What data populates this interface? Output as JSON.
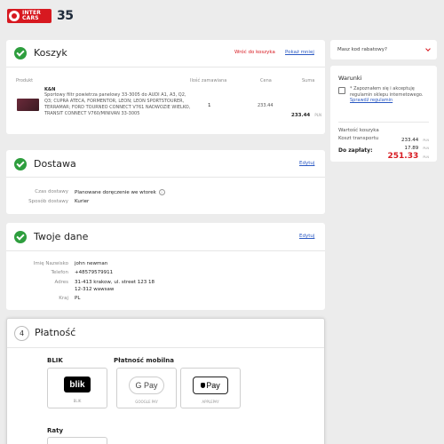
{
  "header": {
    "logo_line1": "INTER",
    "logo_line2": "CARS",
    "anniversary": "35"
  },
  "cart": {
    "title": "Koszyk",
    "return_link": "Wróć do koszyka",
    "show_less": "Pokaż mniej",
    "columns": {
      "product": "Produkt",
      "qty": "Ilość zamawiana",
      "price": "Cena",
      "sum": "Suma"
    },
    "item": {
      "brand": "K&N",
      "description": "Sportowy filtr powietrza panelowy 33-3005 do AUDI A1, A3, Q2, Q3; CUPRA ATECA, FORMENTOR, LEON; LEON SPORTSTOURER, TERRAMAR; FORD TOURNEO CONNECT V761 NADWOZIE WIELKO, TRANSIT CONNECT V760/MINIVAN 33-3005",
      "qty": "1",
      "price": "233.44",
      "sum": "233.44",
      "currency": "PLN"
    }
  },
  "delivery": {
    "title": "Dostawa",
    "edit": "Edytuj",
    "time_label": "Czas dostawy",
    "time_value": "Planowane doręczenie we wtorek",
    "method_label": "Sposób dostawy",
    "method_value": "Kurier"
  },
  "your_data": {
    "title": "Twoje dane",
    "edit": "Edytuj",
    "name_label": "Imię Nazwisko",
    "name_value": "john newman",
    "phone_label": "Telefon",
    "phone_value": "+48579579911",
    "address_label": "Adres",
    "address_line1": "31-413 krakow, ul. street 123 18",
    "address_line2": "12-312 wawsaw",
    "country_label": "Kraj",
    "country_value": "PL"
  },
  "payment": {
    "step": "4",
    "title": "Płatność",
    "blik_heading": "BLIK",
    "mobile_heading": "Płatność mobilna",
    "blik_logo": "blik",
    "blik_caption": "BLIK",
    "gpay_logo": "G Pay",
    "gpay_caption": "GOOGLE PAY",
    "apay_logo": "Pay",
    "apay_caption": "APPLEPAY",
    "installments_heading": "Raty"
  },
  "sidebar": {
    "discount_placeholder": "Masz kod rabatowy?",
    "terms_heading": "Warunki",
    "terms_text": "* Zapoznałem się i akceptuję regulamin sklepu internetowego.",
    "terms_link": "Sprawdź regulamin",
    "cart_value_label": "Wartość koszyka",
    "cart_value": "233.44",
    "shipping_label": "Koszt transportu",
    "shipping_value": "17.89",
    "total_label": "Do zapłaty:",
    "total_value": "251.33",
    "currency": "PLN"
  },
  "colors": {
    "brand_red": "#d71920",
    "check_green": "#2e9e3e",
    "link_blue": "#2b59c3"
  }
}
